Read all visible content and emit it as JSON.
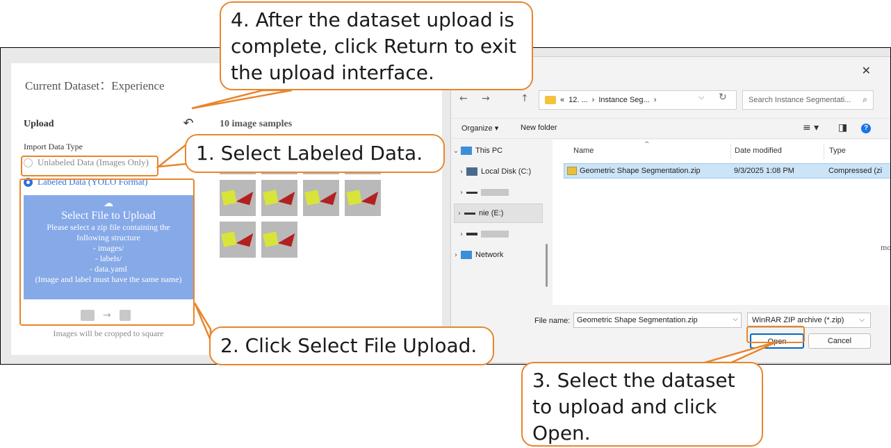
{
  "app": {
    "current_dataset": "Current Dataset：Experience",
    "upload_heading": "Upload",
    "return_icon": "return-arrow-icon",
    "import_type_label": "Import Data Type",
    "option_unlabeled": "Unlabeled Data (Images Only)",
    "option_labeled": "Labeled Data (YOLO Format)",
    "selected_option": "Labeled Data (YOLO Format)",
    "select_file_title": "Select File to Upload",
    "select_file_desc": "Please select a zip file containing the following structure",
    "structure": [
      "- images/",
      "- labels/",
      "- data.yaml"
    ],
    "structure_note": "(Image and label must have the same name)",
    "crop_arrow": "→",
    "crop_note": "Images will be cropped to square",
    "samples_title": "10 image samples",
    "sample_count": 10
  },
  "dialog": {
    "close_glyph": "✕",
    "nav_back": "←",
    "nav_forward": "→",
    "nav_up": "↑",
    "address_prefix": "«",
    "address_seg1": "12. ...",
    "address_sep": "›",
    "address_seg2": "Instance Seg...",
    "address_drop": "⌵",
    "refresh": "↻",
    "search_placeholder": "Search Instance Segmentati...",
    "search_glyph": "⌕",
    "organize": "Organize ▾",
    "new_folder": "New folder",
    "view_glyph": "≡ ▾",
    "pane_glyph": "◨",
    "help_glyph": "?",
    "nav_tree": [
      {
        "label": "This PC",
        "chev": "⌄"
      },
      {
        "label": "Local Disk (C:)",
        "chev": "›"
      },
      {
        "label": "",
        "chev": "›"
      },
      {
        "label": "nie (E:)",
        "chev": "›"
      },
      {
        "label": "",
        "chev": "›"
      },
      {
        "label": "Network",
        "chev": "›"
      }
    ],
    "columns": {
      "name": "Name",
      "date": "Date modified",
      "type": "Type"
    },
    "sort_glyph": "^",
    "files": [
      {
        "name": "Geometric Shape Segmentation.zip",
        "date": "9/3/2025 1:08 PM",
        "type": "Compressed (zi"
      }
    ],
    "file_name_label": "File name:",
    "file_name_value": "Geometric Shape Segmentation.zip",
    "file_drop": "⌵",
    "file_type": "WinRAR ZIP archive (*.zip)",
    "file_type_drop": "⌵",
    "open_label": "Open",
    "cancel_label": "Cancel",
    "cut_off_text": "mod"
  },
  "callouts": {
    "step1": "1. Select Labeled Data.",
    "step2": "2. Click Select File Upload.",
    "step3": [
      "3. Select the dataset",
      "to upload and click",
      "Open."
    ],
    "step4": [
      "4. After the dataset upload is",
      "complete, click Return to exit",
      "the upload interface."
    ]
  },
  "colors": {
    "accent": "#e8852b",
    "select_box": "#86a9e8",
    "radio": "#2f6fde"
  }
}
